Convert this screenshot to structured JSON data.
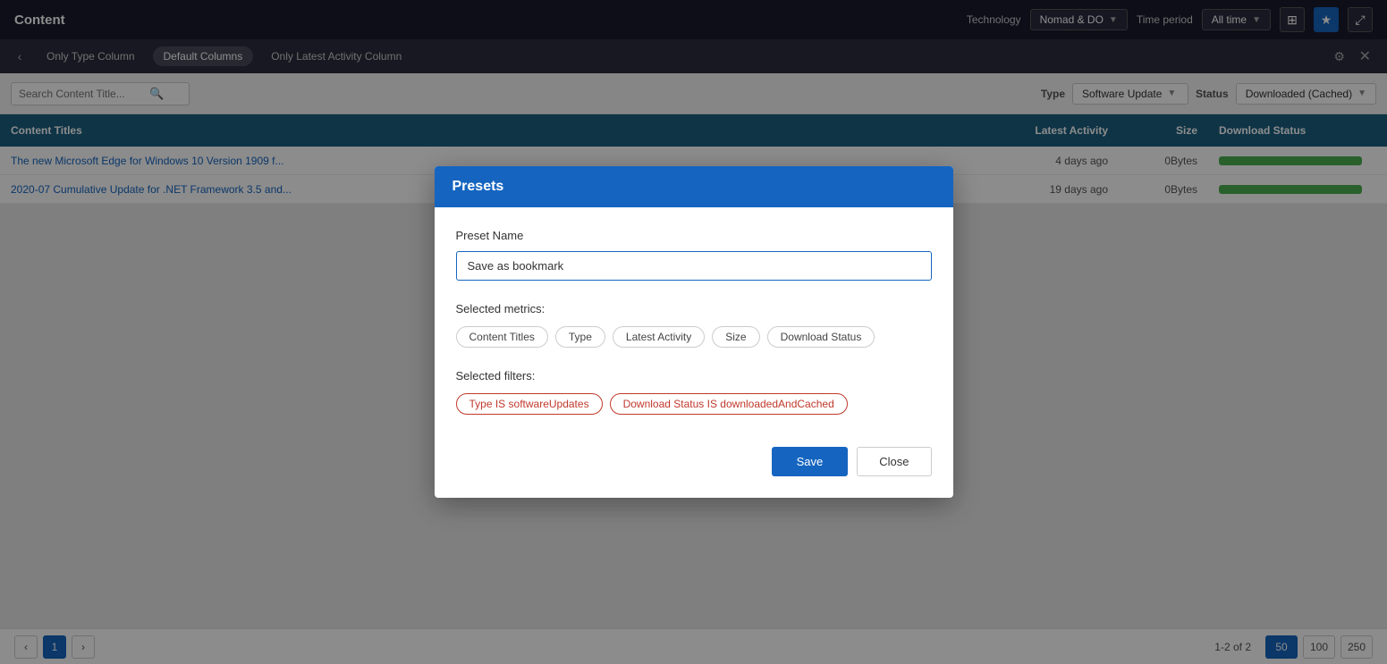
{
  "header": {
    "title": "Content",
    "technology_label": "Technology",
    "technology_value": "Nomad & DO",
    "time_period_label": "Time period",
    "time_period_value": "All time"
  },
  "preset_bar": {
    "tabs": [
      {
        "label": "Only Type Column",
        "active": false
      },
      {
        "label": "Default Columns",
        "active": true
      },
      {
        "label": "Only Latest Activity Column",
        "active": false
      }
    ]
  },
  "filter_bar": {
    "search_placeholder": "Search Content Title...",
    "type_label": "Type",
    "type_value": "Software Update",
    "status_label": "Status",
    "status_value": "Downloaded (Cached)"
  },
  "table": {
    "columns": [
      {
        "label": "Content Titles"
      },
      {
        "label": "Latest Activity"
      },
      {
        "label": "Size"
      },
      {
        "label": "Download Status"
      }
    ],
    "rows": [
      {
        "title": "The new Microsoft Edge for Windows 10 Version 1909 f...",
        "latest_activity": "4 days ago",
        "size": "0Bytes",
        "progress": 100
      },
      {
        "title": "2020-07 Cumulative Update for .NET Framework 3.5 and...",
        "latest_activity": "19 days ago",
        "size": "0Bytes",
        "progress": 100
      }
    ]
  },
  "modal": {
    "title": "Presets",
    "preset_name_label": "Preset Name",
    "preset_name_value": "Save as bookmark",
    "selected_metrics_label": "Selected metrics:",
    "metrics": [
      {
        "label": "Content Titles"
      },
      {
        "label": "Type"
      },
      {
        "label": "Latest Activity"
      },
      {
        "label": "Size"
      },
      {
        "label": "Download Status"
      }
    ],
    "selected_filters_label": "Selected filters:",
    "filters": [
      {
        "label": "Type IS softwareUpdates"
      },
      {
        "label": "Download Status IS downloadedAndCached"
      }
    ],
    "save_btn": "Save",
    "close_btn": "Close"
  },
  "pagination": {
    "prev_label": "‹",
    "next_label": "›",
    "current_page": 1,
    "info": "1-2 of 2",
    "page_sizes": [
      {
        "value": "50",
        "active": true
      },
      {
        "value": "100",
        "active": false
      },
      {
        "value": "250",
        "active": false
      }
    ]
  }
}
